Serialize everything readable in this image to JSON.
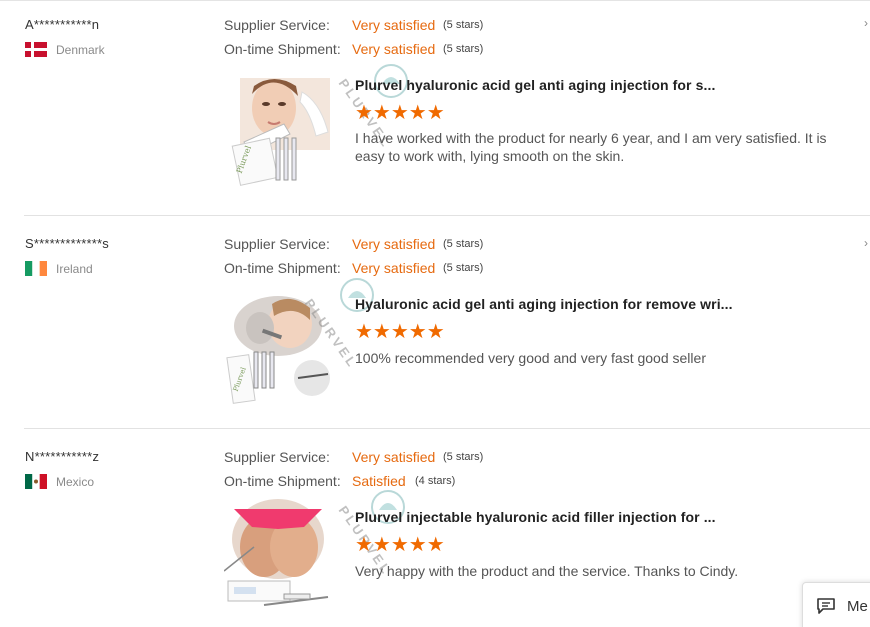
{
  "rating_labels": {
    "supplier": "Supplier Service:",
    "shipment": "On-time Shipment:"
  },
  "reviews": [
    {
      "name": "A***********n",
      "country": "Denmark",
      "supplier_value": "Very satisfied",
      "supplier_stars": "(5 stars)",
      "shipment_value": "Very satisfied",
      "shipment_stars": "(5 stars)",
      "product_title": "Plurvel hyaluronic acid gel anti aging injection for s...",
      "rating": 5,
      "stars_text": "★★★★★",
      "comment": "I have worked with the product for nearly 6 year, and I am very satisfied. It is easy to work with, lying smooth on the skin.",
      "watermark": "PLURVEL"
    },
    {
      "name": "S*************s",
      "country": "Ireland",
      "supplier_value": "Very satisfied",
      "supplier_stars": "(5 stars)",
      "shipment_value": "Very satisfied",
      "shipment_stars": "(5 stars)",
      "product_title": "Hyaluronic acid gel anti aging injection for remove wri...",
      "rating": 5,
      "stars_text": "★★★★★",
      "comment": "100% recommended very good and very fast good seller",
      "watermark": "PLURVEL"
    },
    {
      "name": "N***********z",
      "country": "Mexico",
      "supplier_value": "Very satisfied",
      "supplier_stars": "(5 stars)",
      "shipment_value": "Satisfied",
      "shipment_stars": "(4 stars)",
      "product_title": "Plurvel injectable hyaluronic acid filler injection for ...",
      "rating": 5,
      "stars_text": "★★★★★",
      "comment": "Very happy with the product and the service. Thanks to Cindy.",
      "watermark": "PLURVEL"
    }
  ],
  "message_widget": {
    "label": "Me",
    "icon": "message-icon"
  },
  "colors": {
    "accent": "#e66a10",
    "star": "#f06a00"
  }
}
